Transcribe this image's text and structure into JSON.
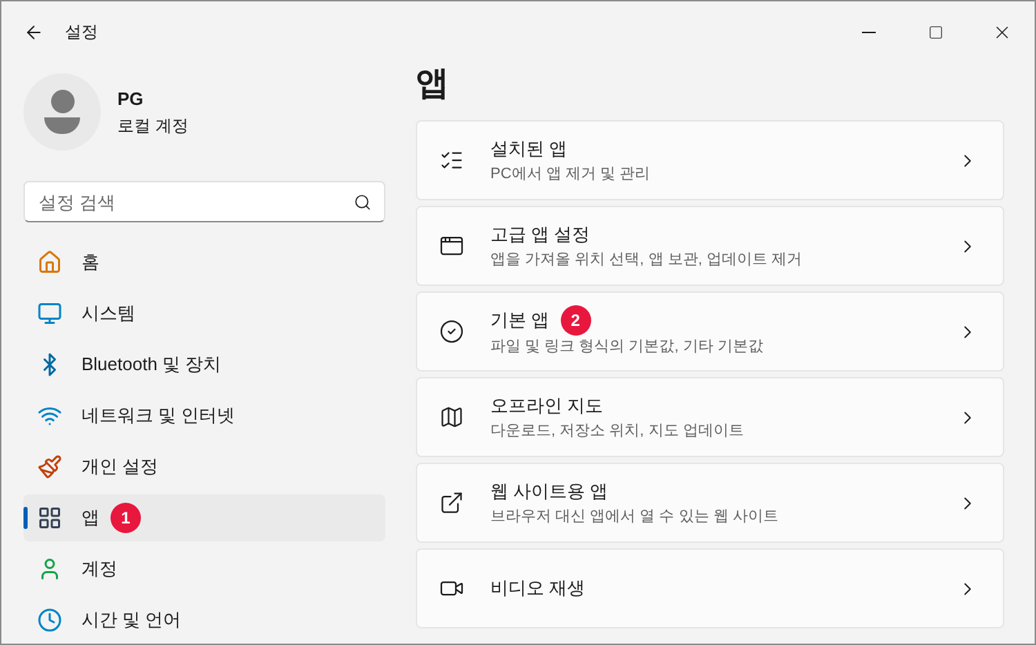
{
  "window": {
    "title": "설정"
  },
  "account": {
    "name": "PG",
    "type": "로컬 계정"
  },
  "search": {
    "placeholder": "설정 검색"
  },
  "sidebar": {
    "items": [
      {
        "label": "홈",
        "selected": false
      },
      {
        "label": "시스템",
        "selected": false
      },
      {
        "label": "Bluetooth 및 장치",
        "selected": false
      },
      {
        "label": "네트워크 및 인터넷",
        "selected": false
      },
      {
        "label": "개인 설정",
        "selected": false
      },
      {
        "label": "앱",
        "selected": true,
        "annotation": "1"
      },
      {
        "label": "계정",
        "selected": false
      },
      {
        "label": "시간 및 언어",
        "selected": false
      }
    ]
  },
  "page": {
    "title": "앱"
  },
  "cards": [
    {
      "title": "설치된 앱",
      "subtitle": "PC에서 앱 제거 및 관리"
    },
    {
      "title": "고급 앱 설정",
      "subtitle": "앱을 가져올 위치 선택, 앱 보관, 업데이트 제거"
    },
    {
      "title": "기본 앱",
      "subtitle": "파일 및 링크 형식의 기본값, 기타 기본값",
      "annotation": "2"
    },
    {
      "title": "오프라인 지도",
      "subtitle": "다운로드, 저장소 위치, 지도 업데이트"
    },
    {
      "title": "웹 사이트용 앱",
      "subtitle": "브라우저 대신 앱에서 열 수 있는 웹 사이트"
    },
    {
      "title": "비디오 재생"
    }
  ]
}
